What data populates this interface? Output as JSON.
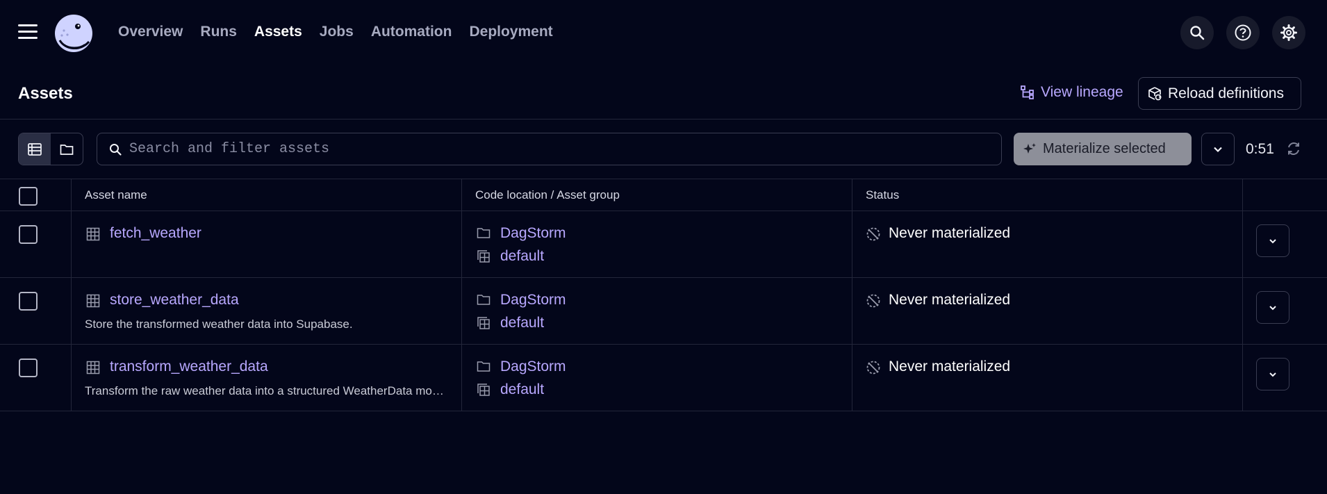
{
  "nav": {
    "links": [
      "Overview",
      "Runs",
      "Assets",
      "Jobs",
      "Automation",
      "Deployment"
    ],
    "active": "Assets",
    "icons": [
      "search-icon",
      "help-icon",
      "gear-icon"
    ]
  },
  "header": {
    "title": "Assets",
    "view_lineage": "View lineage",
    "reload": "Reload definitions"
  },
  "toolbar": {
    "search_placeholder": "Search and filter assets",
    "materialize": "Materialize selected",
    "timer": "0:51"
  },
  "table": {
    "columns": [
      "Asset name",
      "Code location / Asset group",
      "Status"
    ],
    "rows": [
      {
        "name": "fetch_weather",
        "description": "",
        "code_location": "DagStorm",
        "group": "default",
        "status": "Never materialized"
      },
      {
        "name": "store_weather_data",
        "description": "Store the transformed weather data into Supabase.",
        "code_location": "DagStorm",
        "group": "default",
        "status": "Never materialized"
      },
      {
        "name": "transform_weather_data",
        "description": "Transform the raw weather data into a structured WeatherData model.",
        "code_location": "DagStorm",
        "group": "default",
        "status": "Never materialized"
      }
    ]
  },
  "colors": {
    "background": "#03061a",
    "accent_link": "#b8a8ff",
    "border": "#3a3d52"
  }
}
